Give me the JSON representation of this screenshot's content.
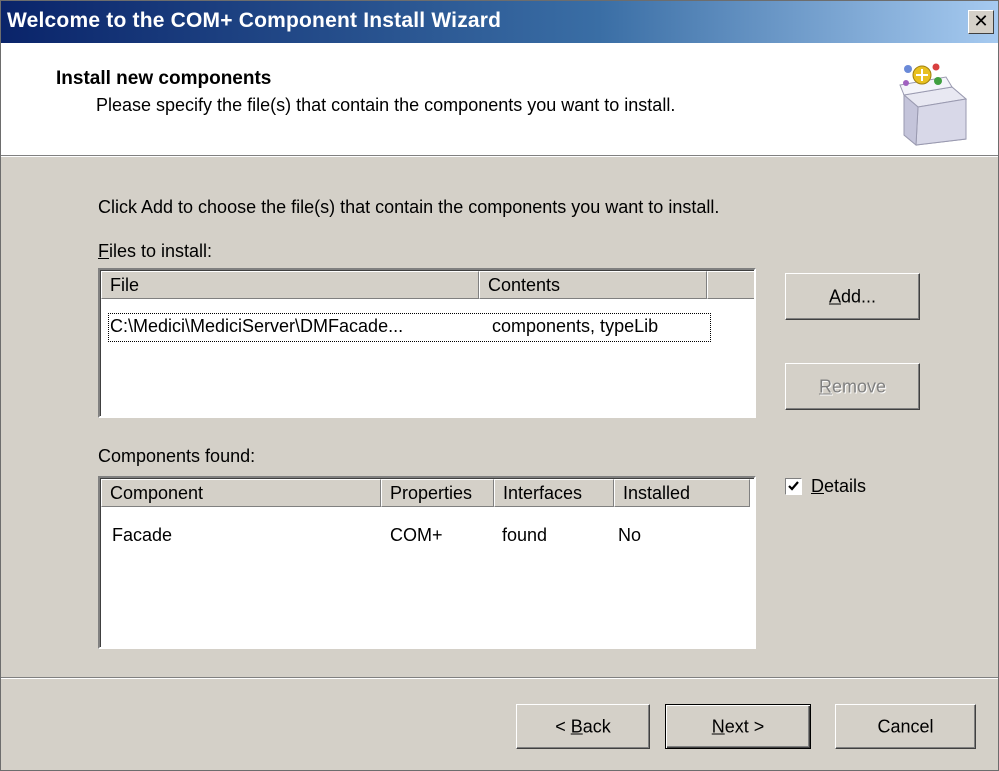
{
  "window": {
    "title": "Welcome to the COM+ Component Install Wizard",
    "close_glyph": "✕"
  },
  "header": {
    "title": "Install new components",
    "subtitle": "Please specify the file(s) that contain the components you want to install.",
    "icon": "package-icon"
  },
  "body": {
    "intro": "Click Add to choose the file(s) that contain the components you want to install."
  },
  "files": {
    "label_accel": "F",
    "label_rest": "iles to install:",
    "columns": [
      "File",
      "Contents"
    ],
    "rows": [
      {
        "file": "C:\\Medici\\MediciServer\\DMFacade...",
        "contents": "components, typeLib"
      }
    ]
  },
  "components": {
    "label": "Components found:",
    "columns": [
      "Component",
      "Properties",
      "Interfaces",
      "Installed"
    ],
    "rows": [
      {
        "component": "Facade",
        "properties": "COM+",
        "interfaces": "found",
        "installed": "No"
      }
    ]
  },
  "buttons": {
    "add_accel": "A",
    "add_rest": "dd...",
    "remove_accel": "R",
    "remove_rest": "emove",
    "back_pre": "< ",
    "back_accel": "B",
    "back_rest": "ack",
    "next_accel": "N",
    "next_rest": "ext >",
    "cancel": "Cancel"
  },
  "details": {
    "checked": true,
    "label_accel": "D",
    "label_rest": "etails"
  }
}
